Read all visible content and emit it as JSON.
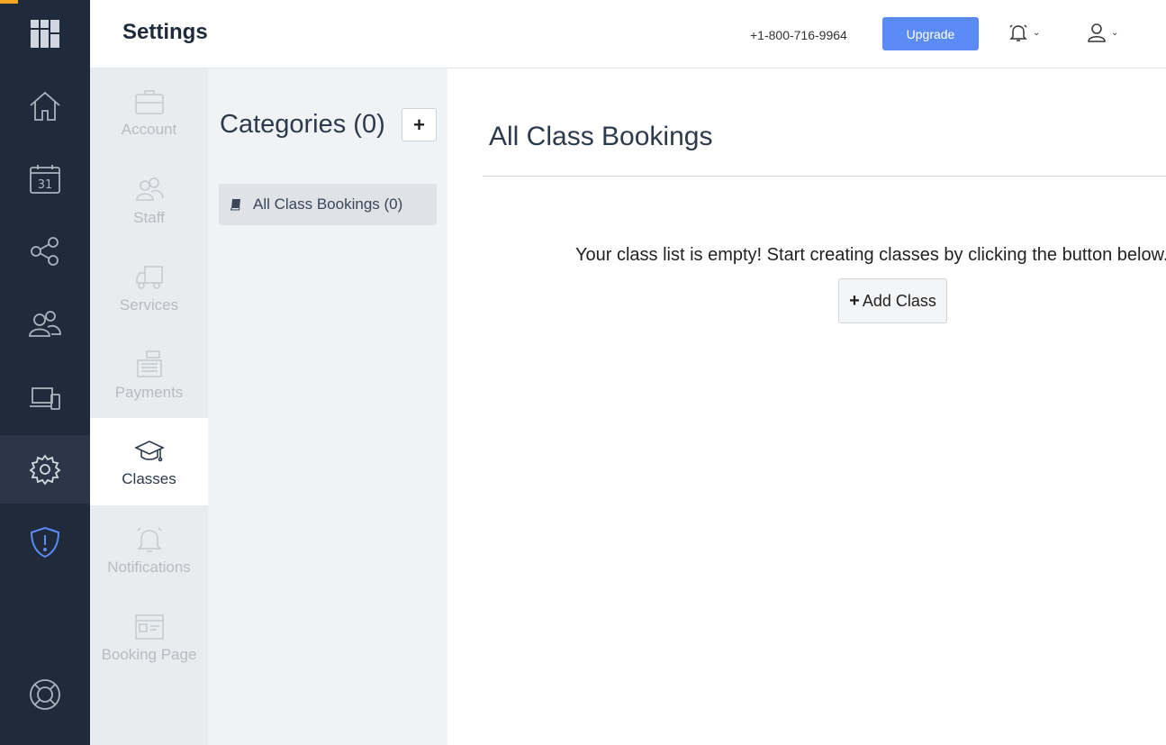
{
  "header": {
    "title": "Settings",
    "phone": "+1-800-716-9964",
    "upgrade_label": "Upgrade"
  },
  "rail": {
    "items": [
      {
        "name": "logo-icon"
      },
      {
        "name": "home-icon"
      },
      {
        "name": "calendar-icon",
        "text": "31"
      },
      {
        "name": "share-icon"
      },
      {
        "name": "users-icon"
      },
      {
        "name": "devices-icon"
      },
      {
        "name": "gear-icon",
        "active": true
      },
      {
        "name": "shield-alert-icon"
      },
      {
        "name": "lifebuoy-icon"
      }
    ],
    "calendar_day": "31"
  },
  "settings_menu": {
    "items": [
      {
        "label": "Account",
        "icon": "briefcase-icon"
      },
      {
        "label": "Staff",
        "icon": "staff-icon"
      },
      {
        "label": "Services",
        "icon": "truck-icon"
      },
      {
        "label": "Payments",
        "icon": "cash-register-icon"
      },
      {
        "label": "Classes",
        "icon": "graduation-cap-icon",
        "active": true
      },
      {
        "label": "Notifications",
        "icon": "bell-icon"
      },
      {
        "label": "Booking Page",
        "icon": "browser-window-icon"
      }
    ]
  },
  "categories": {
    "title": "Categories (0)",
    "add_label": "+",
    "items": [
      {
        "label": "All Class Bookings (0)",
        "icon": "book-icon"
      }
    ]
  },
  "main": {
    "title": "All Class Bookings",
    "empty_message": "Your class list is empty! Start creating classes by clicking the button below.",
    "add_class_plus": "+",
    "add_class_label": "Add Class"
  },
  "colors": {
    "rail_bg": "#1f2b3b",
    "accent": "#5b8cf5",
    "warning_accent": "#f5a623"
  }
}
